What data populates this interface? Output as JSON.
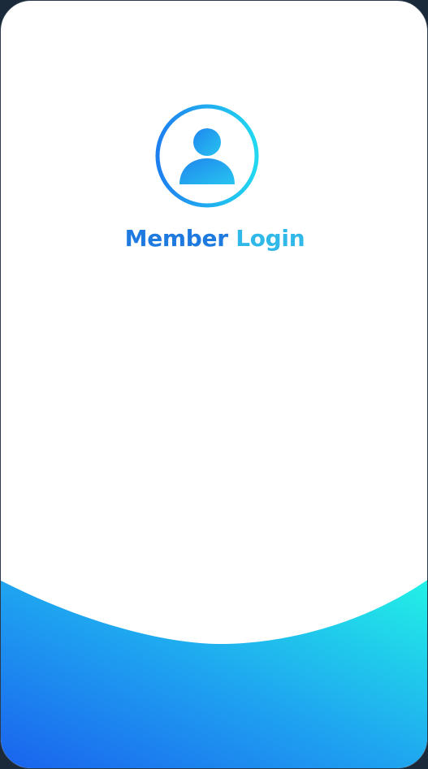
{
  "screen": {
    "title_part1": "Member",
    "title_part2": "Login",
    "icon": "user-avatar-icon"
  },
  "colors": {
    "gradient_start": "#1e6ff0",
    "gradient_end": "#1ef0e6",
    "background": "#ffffff"
  }
}
